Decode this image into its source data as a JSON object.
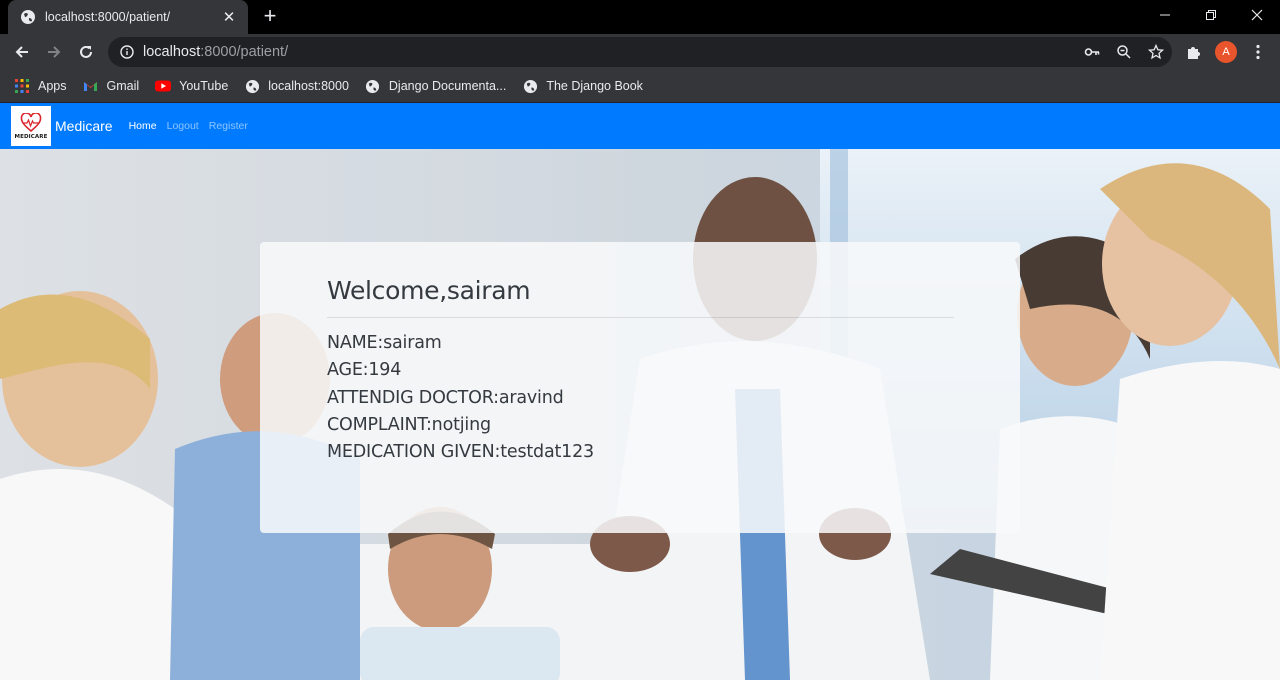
{
  "browser": {
    "tab_title": "localhost:8000/patient/",
    "url_host": "localhost",
    "url_path": ":8000/patient/",
    "profile_initial": "A",
    "bookmarks": [
      {
        "label": "Apps",
        "icon": "apps-grid-icon"
      },
      {
        "label": "Gmail",
        "icon": "gmail-icon"
      },
      {
        "label": "YouTube",
        "icon": "youtube-icon"
      },
      {
        "label": "localhost:8000",
        "icon": "globe-icon"
      },
      {
        "label": "Django Documenta...",
        "icon": "globe-icon"
      },
      {
        "label": "The Django Book",
        "icon": "globe-icon"
      }
    ]
  },
  "navbar": {
    "logo_text": "MEDICARE",
    "brand": "Medicare",
    "links": [
      "Home",
      "Logout",
      "Register"
    ]
  },
  "card": {
    "heading": "Welcome,sairam",
    "fields": [
      "NAME:sairam",
      "AGE:194",
      "ATTENDIG DOCTOR:aravind",
      "COMPLAINT:notjing",
      "MEDICATION GIVEN:testdat123"
    ]
  },
  "colors": {
    "navbar_bg": "#007bff",
    "avatar_bg": "#e8542c"
  }
}
